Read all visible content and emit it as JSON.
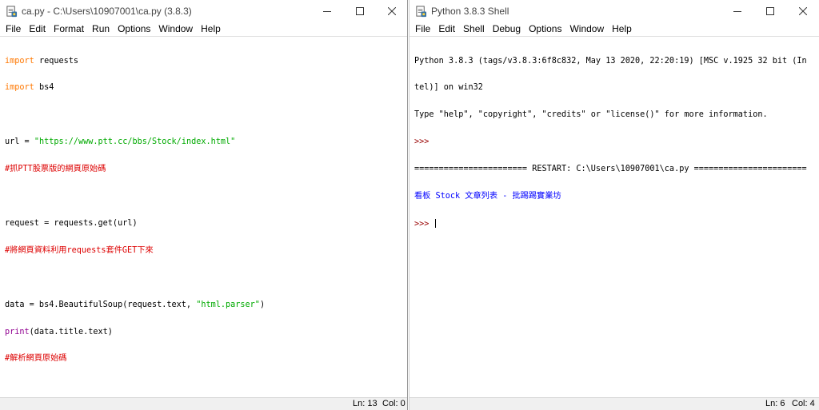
{
  "editor": {
    "title": "ca.py - C:\\Users\\10907001\\ca.py (3.8.3)",
    "menu": [
      "File",
      "Edit",
      "Format",
      "Run",
      "Options",
      "Window",
      "Help"
    ],
    "code": {
      "l1_kw": "import",
      "l1_rest": " requests",
      "l2_kw": "import",
      "l2_rest": " bs4",
      "l4_a": "url = ",
      "l4_str": "\"https://www.ptt.cc/bbs/Stock/index.html\"",
      "l5_cmt": "#抓PTT股票版的網頁原始碼",
      "l7": "request = requests.get(url)",
      "l8_cmt": "#將網頁資料利用requests套件GET下來",
      "l10_a": "data = bs4.BeautifulSoup(request.text, ",
      "l10_str": "\"html.parser\"",
      "l10_b": ")",
      "l11_bi": "print",
      "l11_rest": "(data.title.text)",
      "l12_cmt": "#解析網頁原始碼"
    },
    "status": {
      "ln": "Ln: 13",
      "col": "Col: 0"
    }
  },
  "shell": {
    "title": "Python 3.8.3 Shell",
    "menu": [
      "File",
      "Edit",
      "Shell",
      "Debug",
      "Options",
      "Window",
      "Help"
    ],
    "lines": {
      "banner1": "Python 3.8.3 (tags/v3.8.3:6f8c832, May 13 2020, 22:20:19) [MSC v.1925 32 bit (In",
      "banner2": "tel)] on win32",
      "banner3": "Type \"help\", \"copyright\", \"credits\" or \"license()\" for more information.",
      "prompt": ">>>",
      "restart": "======================= RESTART: C:\\Users\\10907001\\ca.py =======================",
      "output": "看板 Stock 文章列表 - 批踢踢實業坊"
    },
    "status": {
      "ln": "Ln: 6",
      "col": "Col: 4"
    }
  },
  "icons": {
    "app": "python-idle-icon",
    "minimize": "minimize-icon",
    "maximize": "maximize-icon",
    "close": "close-icon"
  }
}
